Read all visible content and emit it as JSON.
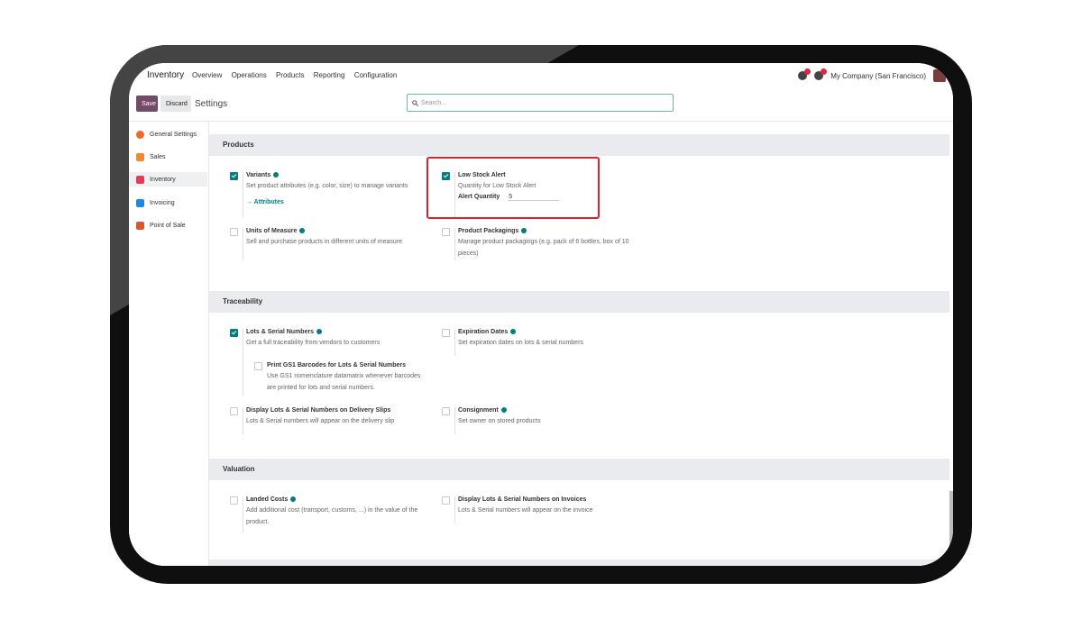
{
  "nav": {
    "app": "Inventory",
    "menu": [
      "Overview",
      "Operations",
      "Products",
      "Reporting",
      "Configuration"
    ],
    "company": "My Company (San Francisco)"
  },
  "control": {
    "save": "Save",
    "discard": "Discard",
    "breadcrumb": "Settings",
    "search_placeholder": "Search..."
  },
  "sidebar": [
    {
      "label": "General Settings",
      "color": "#f06a26"
    },
    {
      "label": "Sales",
      "color": "#f28b30"
    },
    {
      "label": "Inventory",
      "color": "#e63c5a"
    },
    {
      "label": "Invoicing",
      "color": "#1e88e5"
    },
    {
      "label": "Point of Sale",
      "color": "#d9572b"
    }
  ],
  "sections": {
    "products": "Products",
    "traceability": "Traceability",
    "valuation": "Valuation"
  },
  "settings": {
    "variants": {
      "title": "Variants",
      "desc": "Set product attributes (e.g. color, size) to manage variants",
      "link": "→ Attributes",
      "checked": true
    },
    "low_stock": {
      "title": "Low Stock Alert",
      "desc": "Quantity for Low Stock Alert",
      "qty_label": "Alert Quantity",
      "qty_value": "5",
      "checked": true
    },
    "uom": {
      "title": "Units of Measure",
      "desc": "Sell and purchase products in different units of measure",
      "checked": false
    },
    "packagings": {
      "title": "Product Packagings",
      "desc": "Manage product packagings (e.g. pack of 6 bottles, box of 10 pieces)",
      "checked": false
    },
    "lots": {
      "title": "Lots & Serial Numbers",
      "desc": "Get a full traceability from vendors to customers",
      "checked": true
    },
    "expiration": {
      "title": "Expiration Dates",
      "desc": "Set expiration dates on lots & serial numbers",
      "checked": false
    },
    "gs1": {
      "title": "Print GS1 Barcodes for Lots & Serial Numbers",
      "desc": "Use GS1 nomenclature datamatrix whenever barcodes are printed for lots and serial numbers.",
      "checked": false
    },
    "delivery_slips": {
      "title": "Display Lots & Serial Numbers on Delivery Slips",
      "desc": "Lots & Serial numbers will appear on the delivery slip",
      "checked": false
    },
    "consignment": {
      "title": "Consignment",
      "desc": "Set owner on stored products",
      "checked": false
    },
    "landed": {
      "title": "Landed Costs",
      "desc": "Add additional cost (transport, customs, ...) in the value of the product.",
      "checked": false
    },
    "invoices_lots": {
      "title": "Display Lots & Serial Numbers on Invoices",
      "desc": "Lots & Serial numbers will appear on the invoice",
      "checked": false
    }
  }
}
